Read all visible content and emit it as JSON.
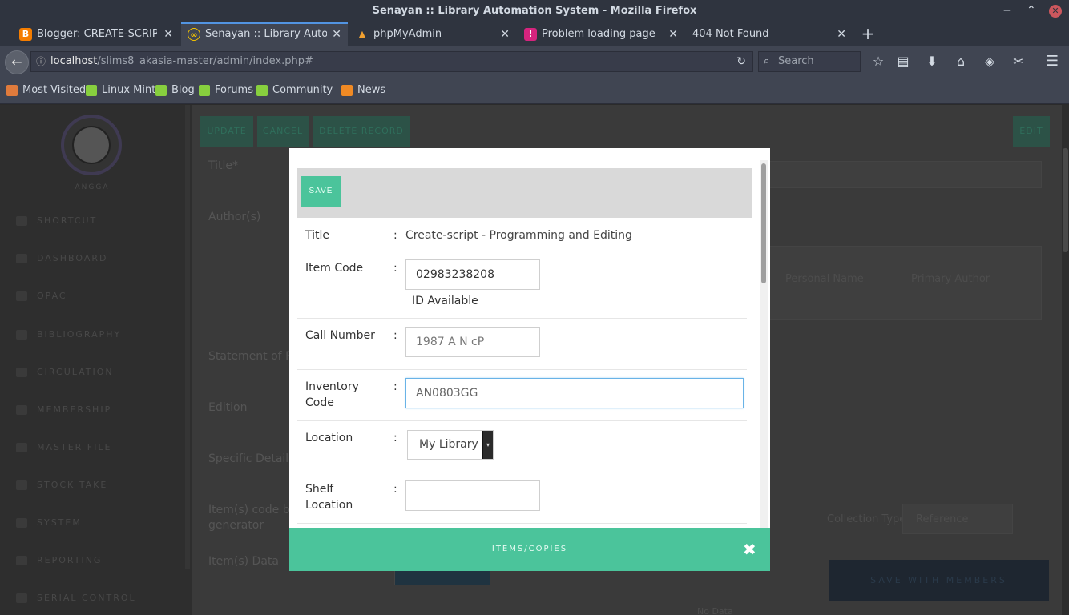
{
  "window": {
    "title": "Senayan :: Library Automation System - Mozilla Firefox",
    "minimize": "‒",
    "maximize": "⌃",
    "close": "✕"
  },
  "tabs": [
    {
      "label": "Blogger: CREATE-SCRIPT - A",
      "icon": "blogger-icon",
      "color": "#f57d00"
    },
    {
      "label": "Senayan :: Library Automat",
      "icon": "senayan-icon",
      "color": "#f2c200"
    },
    {
      "label": "phpMyAdmin",
      "icon": "phpmyadmin-icon",
      "color": "#f0a030"
    },
    {
      "label": "Problem loading page",
      "icon": "warning-icon",
      "color": "#d6247e"
    },
    {
      "label": "404 Not Found",
      "icon": "",
      "color": ""
    }
  ],
  "tab_close": "✕",
  "new_tab": "+",
  "nav": {
    "back": "←",
    "info": "ⓘ",
    "url_host": "localhost",
    "url_path": "/slims8_akasia-master/admin/index.php#",
    "reload": "↻",
    "search_placeholder": "Search",
    "search_icon": "⌕",
    "icons": [
      "☆",
      "▤",
      "⬇",
      "⌂",
      "◈",
      "✂",
      "☰"
    ]
  },
  "bookmarks": [
    {
      "label": "Most Visited",
      "color": "#e07b3c"
    },
    {
      "label": "Linux Mint",
      "color": "#87cf3e"
    },
    {
      "label": "Blog",
      "color": "#87cf3e"
    },
    {
      "label": "Forums",
      "color": "#87cf3e"
    },
    {
      "label": "Community",
      "color": "#87cf3e"
    },
    {
      "label": "News",
      "color": "#f08a24"
    }
  ],
  "background": {
    "user": "ANGGA",
    "menu": [
      "SHORTCUT",
      "DASHBOARD",
      "OPAC",
      "BIBLIOGRAPHY",
      "CIRCULATION",
      "MEMBERSHIP",
      "MASTER FILE",
      "STOCK TAKE",
      "SYSTEM",
      "REPORTING",
      "SERIAL CONTROL"
    ],
    "buttons": [
      "UPDATE",
      "CANCEL",
      "DELETE RECORD",
      "EDIT"
    ],
    "labels": {
      "title": "Title*",
      "authors": "Author(s)",
      "statement": "Statement of Re",
      "edition": "Edition",
      "specific": "Specific Detail I",
      "itemcode_1": "Item(s) code ba",
      "itemcode_2": "generator",
      "itemsdata": "Item(s) Data"
    },
    "author_cols": [
      "Personal Name",
      "Primary Author"
    ],
    "collection_type_label": "Collection Type",
    "collection_type_value": "Reference",
    "dark_button": "SAVE WITH MEMBERS",
    "bottom_text": "No Data"
  },
  "modal": {
    "save_label": "SAVE",
    "colon": ":",
    "title_label": "Title",
    "title_value": "Create-script - Programming and Editing",
    "item_code_label": "Item Code",
    "item_code_value": "02983238208",
    "item_code_note": "ID Available",
    "call_number_label": "Call Number",
    "call_number_value": "1987 A N cP",
    "inventory_label_1": "Inventory",
    "inventory_label_2": "Code",
    "inventory_value": "AN0803GG",
    "location_label": "Location",
    "location_value": "My Library",
    "location_arrow": "▾",
    "shelf_label_1": "Shelf",
    "shelf_label_2": "Location",
    "shelf_value": "",
    "footer_title": "ITEMS/COPIES",
    "footer_close": "✖"
  },
  "colors": {
    "accent_green": "#4bc49b",
    "focus_blue": "#69b3e7"
  }
}
